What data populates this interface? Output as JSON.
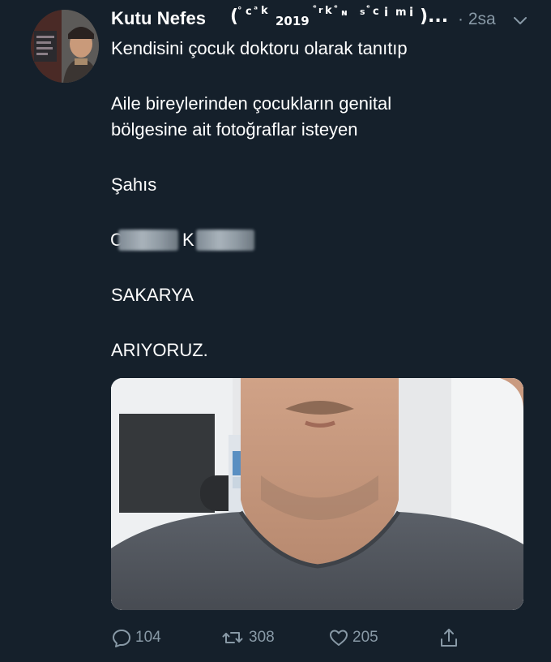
{
  "tweet": {
    "author_name": "Kutu Nefes",
    "name_decoration": [
      "(",
      "°",
      "c",
      "ᵃ",
      "k",
      "2019",
      "ᵉ",
      "r",
      "k",
      "ᵉ",
      "ɴ",
      "s",
      "ᵉ",
      "c",
      "𝗶",
      "m",
      "𝗶",
      ")..."
    ],
    "time": "· 2sa",
    "lines": [
      "Kendisini çocuk doktoru olarak tanıtıp",
      "Aile bireylerinden çocukların genital",
      "bölgesine ait fotoğraflar isteyen",
      "Şahıs",
      "SAKARYA",
      "ARIYORUZ."
    ],
    "redacted_name": {
      "first_initial": "C",
      "last_initial": "K"
    },
    "actions": {
      "reply_count": "104",
      "retweet_count": "308",
      "like_count": "205"
    }
  },
  "icons": {
    "caret": "chevron-down-icon",
    "reply": "reply-icon",
    "retweet": "retweet-icon",
    "like": "heart-icon",
    "share": "share-icon"
  },
  "colors": {
    "background": "#15202b",
    "text": "#ffffff",
    "muted": "#8899a6"
  }
}
